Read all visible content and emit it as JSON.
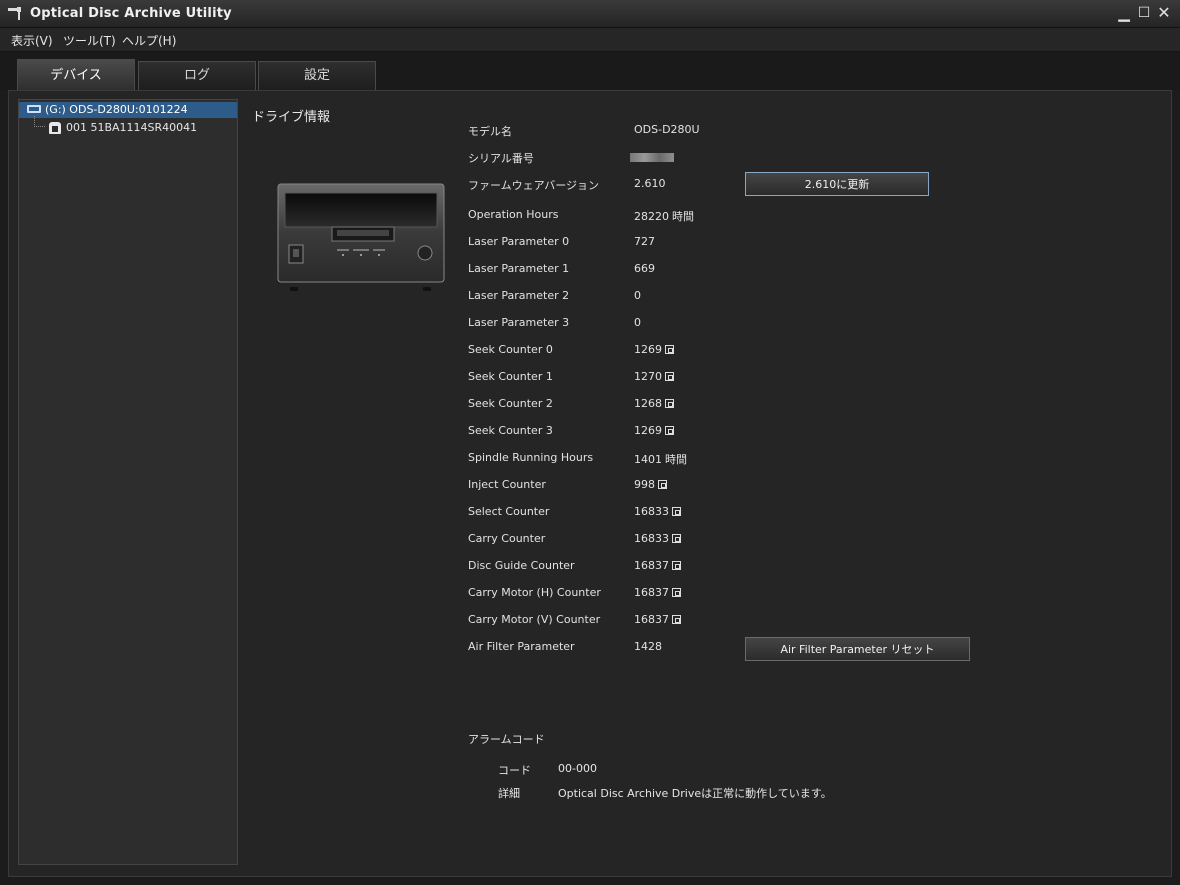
{
  "window": {
    "title": "Optical Disc Archive Utility",
    "minimize": "▁",
    "maximize": "☐",
    "close": "✕"
  },
  "menu": [
    {
      "label": "表示(V)"
    },
    {
      "label": "ツール(T)"
    },
    {
      "label": "ヘルプ(H)"
    }
  ],
  "tabs": [
    {
      "label": "デバイス",
      "active": true
    },
    {
      "label": "ログ"
    },
    {
      "label": "設定"
    }
  ],
  "tree": {
    "drive": "(G:) ODS-D280U:0101224",
    "cartridge": "001 51BA1114SR40041"
  },
  "section_title": "ドライブ情報",
  "info": {
    "model": {
      "label": "モデル名",
      "value": "ODS-D280U"
    },
    "serial": {
      "label": "シリアル番号"
    },
    "firmware": {
      "label": "ファームウェアバージョン",
      "value": "2.610",
      "button": "2.610に更新"
    },
    "operation_hours": {
      "label": "Operation Hours",
      "value": "28220",
      "unit": "時間"
    },
    "laser0": {
      "label": "Laser Parameter 0",
      "value": "727"
    },
    "laser1": {
      "label": "Laser Parameter 1",
      "value": "669"
    },
    "laser2": {
      "label": "Laser Parameter 2",
      "value": "0"
    },
    "laser3": {
      "label": "Laser Parameter 3",
      "value": "0"
    },
    "seek0": {
      "label": "Seek Counter 0",
      "value": "1269"
    },
    "seek1": {
      "label": "Seek Counter 1",
      "value": "1270"
    },
    "seek2": {
      "label": "Seek Counter 2",
      "value": "1268"
    },
    "seek3": {
      "label": "Seek Counter 3",
      "value": "1269"
    },
    "spindle": {
      "label": "Spindle Running Hours",
      "value": "1401",
      "unit": "時間"
    },
    "inject": {
      "label": "Inject Counter",
      "value": "998"
    },
    "select": {
      "label": "Select Counter",
      "value": "16833"
    },
    "carry": {
      "label": "Carry Counter",
      "value": "16833"
    },
    "disc_guide": {
      "label": "Disc Guide Counter",
      "value": "16837"
    },
    "carry_h": {
      "label": "Carry Motor (H) Counter",
      "value": "16837"
    },
    "carry_v": {
      "label": "Carry Motor (V) Counter",
      "value": "16837"
    },
    "air_filter": {
      "label": "Air Filter Parameter",
      "value": "1428",
      "button": "Air Filter Parameter リセット"
    }
  },
  "alarm": {
    "title": "アラームコード",
    "code_label": "コード",
    "code_value": "00-000",
    "detail_label": "詳細",
    "detail_value": "Optical Disc Archive Driveは正常に動作しています。"
  }
}
